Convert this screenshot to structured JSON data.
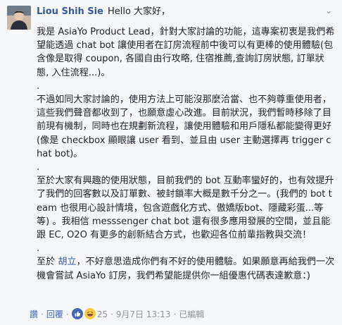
{
  "comment": {
    "author": "Liou Shih Sie",
    "greeting": "Hello 大家好，",
    "para1": "我是 AsiaYo Product Lead，針對大家討論的功能，這專案初衷是我們希望能透過 chat bot 讓使用者在訂房流程前中後可以有更棒的使用體驗(包含像是取得 coupon, 各國自由行攻略, 住宿推薦,查詢訂房狀態, 訂單狀態, 入住流程...)。",
    "sep1": ".",
    "para2": "不過如同大家討論的，使用方法上可能沒那麼洽當、也不夠尊重使用者，這些我們聲音都收到了，也願意虛心改進。目前狀況，我們暫時移除了目前現有機制，同時也在規劃新流程，讓使用體驗和用戶隱私都能變得更好(像是 checkbox 顯眼讓 user 看到、並且由 user 主動選擇再 trigger chat bot)。",
    "sep2": ".",
    "para3": "至於大家有興趣的使用狀態，目前我們的 bot 互動率蠻好的，也有效提升了我們的回客數以及訂單數、被封鎖率大概是數千分之一。(我們的 bot team 也很用心設計情境，包含遊戲化方式、傲嬌版bot、隱藏彩蛋...等等) 。我相信 messsenger chat bot 還有很多應用發展的空間，並且能跟 EC, O2O 有更多的創新結合方式，也歡迎各位前輩指教與交流！",
    "sep3": ".",
    "para4_pre": "至於 ",
    "para4_mention": "胡立",
    "para4_post": "，不好意思造成你們有不好的使用體驗。如果願意再給我們一次機會嘗試 AsiaYo 訂房，我們希望能提供你一組優惠代碼表達歉意：)"
  },
  "actions": {
    "like": "讚",
    "reply": "回覆",
    "reaction_count": "25",
    "date": "9月7日 13:13",
    "edited": "已編輯"
  },
  "icons": {
    "avatar": "profile-avatar",
    "chevron": "chevron-down-icon",
    "reactions": [
      "like-icon",
      "haha-icon"
    ]
  },
  "colors": {
    "link": "#365899",
    "action_link": "#4267b2",
    "muted": "#90949c",
    "background": "#f6f7f9"
  }
}
